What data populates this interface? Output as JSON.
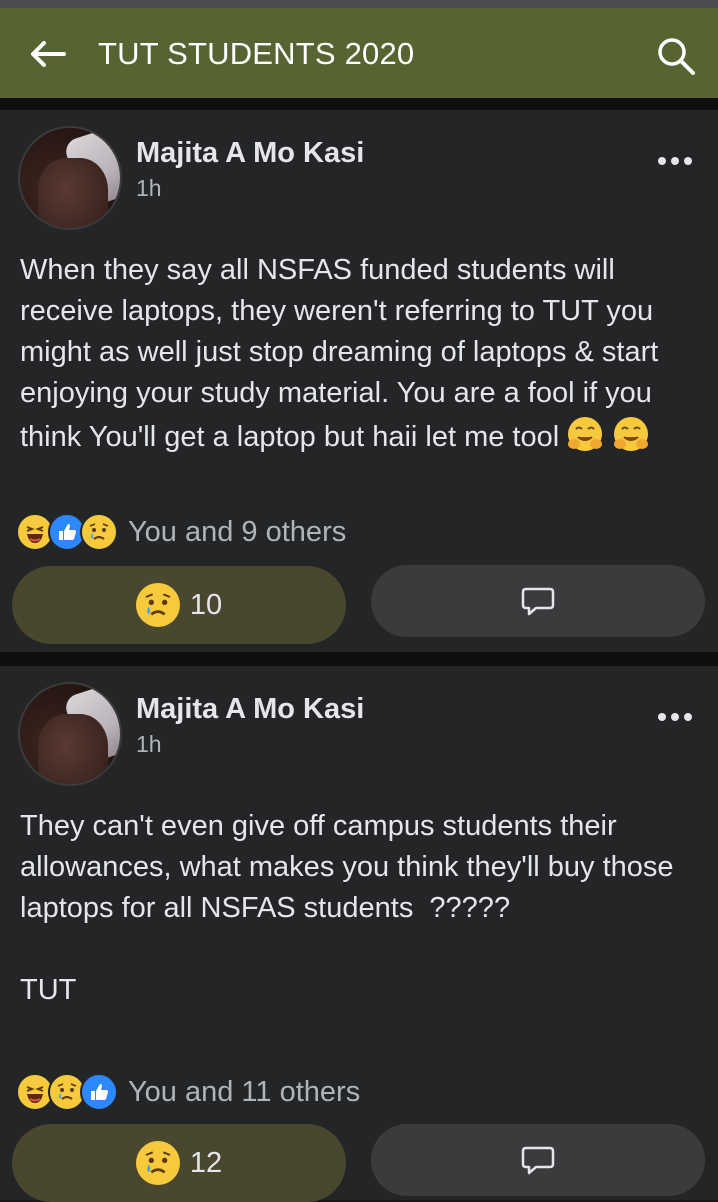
{
  "header": {
    "title": "TUT STUDENTS 2020",
    "back_icon": "arrow-left-icon",
    "search_icon": "search-icon",
    "background": "#566431"
  },
  "posts": [
    {
      "author": "Majita A Mo Kasi",
      "time": "1h",
      "body": "When they say all NSFAS funded students will receive laptops, they weren't referring to TUT you might as well just stop dreaming of laptops & start enjoying your study material. You are a fool if you think You'll get a laptop but haii let me tool",
      "body_emojis": [
        "hugging-face-emoji",
        "hugging-face-emoji"
      ],
      "reaction_icons": [
        "haha-reaction-icon",
        "like-reaction-icon",
        "sad-reaction-icon"
      ],
      "reactions_text": "You and 9 others",
      "react_button_count": "10",
      "react_button_icon": "sad-reaction-icon",
      "comment_icon": "comment-icon"
    },
    {
      "author": "Majita A Mo Kasi",
      "time": "1h",
      "body": "They can't even give off campus students their allowances, what makes you think they'll buy those laptops for all NSFAS students  ?????\n\nTUT",
      "reaction_icons": [
        "haha-reaction-icon",
        "sad-reaction-icon",
        "like-reaction-icon"
      ],
      "reactions_text": "You and 11 others",
      "react_button_count": "12",
      "react_button_icon": "sad-reaction-icon",
      "comment_icon": "comment-icon"
    }
  ],
  "colors": {
    "like": "#2d88ff",
    "emoji_yellow": "#f7c93c",
    "reacted_button": "#4a472f",
    "card": "#242526"
  }
}
